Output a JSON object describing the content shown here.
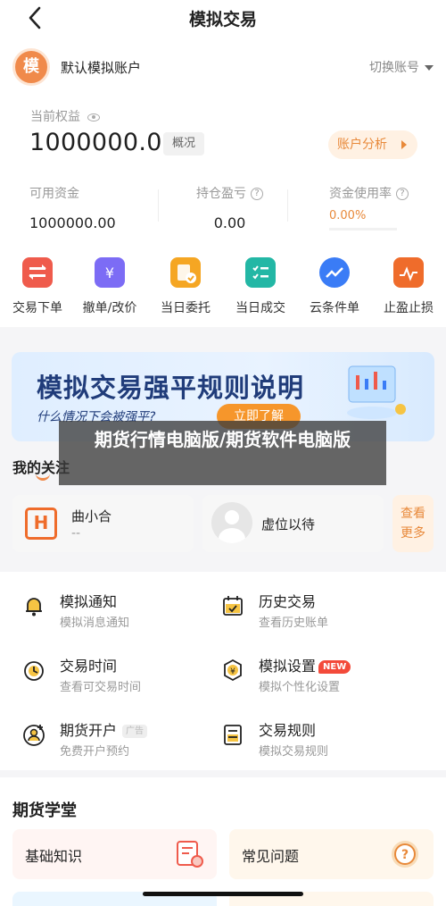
{
  "header": {
    "title": "模拟交易"
  },
  "account": {
    "avatar_char": "模",
    "name": "默认模拟账户",
    "switch_label": "切换账号"
  },
  "equity": {
    "label": "当前权益",
    "value": "1000000.00",
    "tag": "概况",
    "analysis_button": "账户分析"
  },
  "stats": [
    {
      "label": "可用资金",
      "value": "1000000.00"
    },
    {
      "label": "持仓盈亏",
      "value": "0.00"
    },
    {
      "label": "资金使用率",
      "value": "0.00%"
    }
  ],
  "quick_actions": [
    {
      "label": "交易下单",
      "icon": "trade-order-icon",
      "color": "#ef5b4c"
    },
    {
      "label": "撤单/改价",
      "icon": "cancel-order-icon",
      "color": "#7c6cf5"
    },
    {
      "label": "当日委托",
      "icon": "daily-order-icon",
      "color": "#f5a623"
    },
    {
      "label": "当日成交",
      "icon": "daily-deal-icon",
      "color": "#23b7a5"
    },
    {
      "label": "云条件单",
      "icon": "cloud-condition-icon",
      "color": "#3a7cf6"
    },
    {
      "label": "止盈止损",
      "icon": "stop-profit-loss-icon",
      "color": "#ef6c2b"
    }
  ],
  "banner": {
    "title": "模拟交易强平规则说明",
    "subtitle": "什么情况下会被强平?",
    "button": "立即了解"
  },
  "overlay_text": "期货行情电脑版/期货软件电脑版",
  "focus": {
    "title": "我的关注",
    "cards": [
      {
        "name": "曲小合",
        "sub": "--"
      },
      {
        "name": "虚位以待",
        "sub": ""
      }
    ],
    "see_more": "查看更多"
  },
  "menu": [
    {
      "title": "模拟通知",
      "sub": "模拟消息通知",
      "icon": "bell-icon"
    },
    {
      "title": "历史交易",
      "sub": "查看历史账单",
      "icon": "calendar-check-icon"
    },
    {
      "title": "交易时间",
      "sub": "查看可交易时间",
      "icon": "clock-icon"
    },
    {
      "title": "模拟设置",
      "sub": "模拟个性化设置",
      "icon": "settings-icon",
      "badge": "NEW"
    },
    {
      "title": "期货开户",
      "sub": "免费开户预约",
      "icon": "account-open-icon",
      "badge": "广告"
    },
    {
      "title": "交易规则",
      "sub": "模拟交易规则",
      "icon": "rules-document-icon"
    }
  ],
  "school": {
    "title": "期货学堂",
    "cards": [
      {
        "title": "基础知识",
        "icon": "basic-knowledge-icon"
      },
      {
        "title": "常见问题",
        "icon": "faq-icon"
      }
    ]
  }
}
